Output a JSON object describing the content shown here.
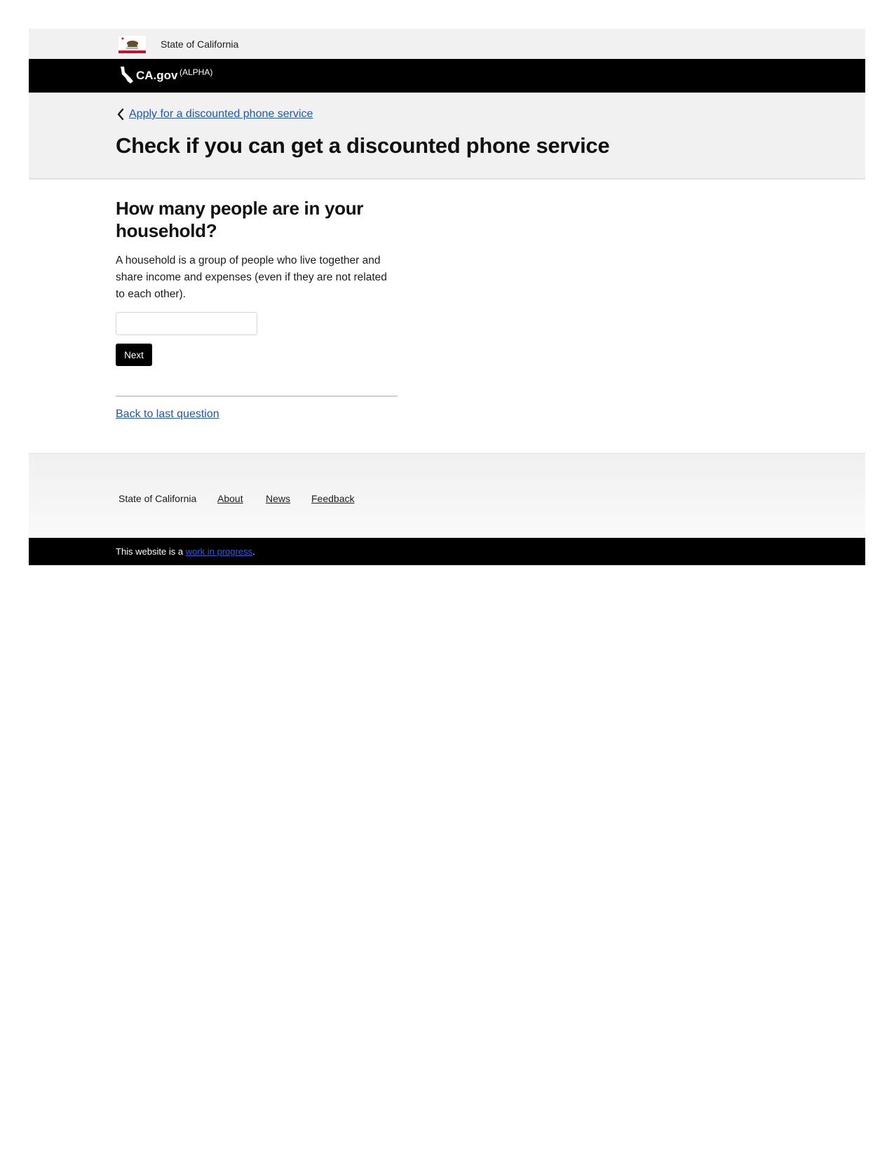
{
  "utility_bar": {
    "label": "State of California",
    "seal_icon": "california-seal-icon"
  },
  "brand": {
    "name": "CA.gov",
    "badge": "(ALPHA)",
    "icon": "california-shape-icon"
  },
  "header": {
    "parent_link": "Apply for a discounted phone service",
    "title": "Check if you can get a discounted phone service"
  },
  "form": {
    "question": "How many people are in your household?",
    "hint": "A household is a group of people who live together and share income and expenses (even if they are not related to each other).",
    "household_value": "",
    "next_label": "Next",
    "back_label": "Back to last question"
  },
  "footer": {
    "links": [
      "State of California",
      "About",
      "News",
      "Feedback"
    ],
    "note_prefix": "This website is a ",
    "note_link": "work in progress",
    "note_suffix": "."
  },
  "colors": {
    "link": "#1f56b8",
    "brand_bar": "#000000",
    "band": "#f1f1f1"
  }
}
